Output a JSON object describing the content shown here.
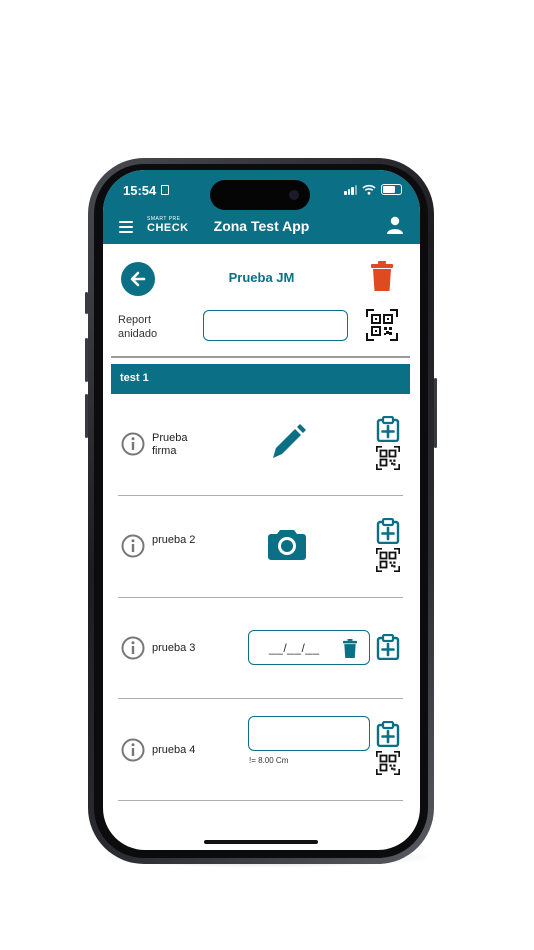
{
  "status": {
    "time": "15:54"
  },
  "header": {
    "logo_top": "SMART PRE",
    "logo_bottom": "CHECK",
    "title": "Zona Test App"
  },
  "page": {
    "title": "Prueba JM",
    "report_label": "Report anidado",
    "report_value": ""
  },
  "section": {
    "title": "test 1"
  },
  "items": [
    {
      "label": "Prueba firma",
      "control": "signature"
    },
    {
      "label": "prueba 2",
      "control": "photo"
    },
    {
      "label": "prueba 3",
      "control": "date",
      "value": "__/__/__"
    },
    {
      "label": "prueba 4",
      "control": "number",
      "value": "",
      "hint": "!= 8.00 Cm"
    }
  ],
  "colors": {
    "primary": "#0b6f86",
    "danger": "#e04a22"
  },
  "icons": {
    "menu": "hamburger-icon",
    "user": "user-icon",
    "back": "arrow-left-icon",
    "delete": "trash-icon",
    "qr": "qr-code-icon",
    "info": "info-icon",
    "add": "clipboard-plus-icon",
    "signature": "pencil-icon",
    "photo": "camera-icon"
  }
}
